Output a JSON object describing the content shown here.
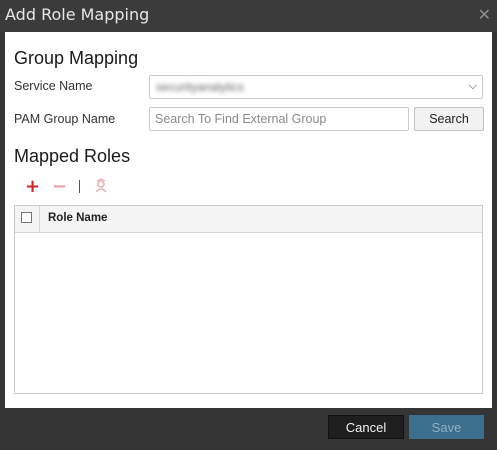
{
  "dialog": {
    "title": "Add Role Mapping",
    "close_icon": "close-icon"
  },
  "group_mapping": {
    "heading": "Group Mapping",
    "service_name_label": "Service Name",
    "service_name_value": "securityanalytics",
    "pam_group_label": "PAM Group Name",
    "pam_group_placeholder": "Search To Find External Group",
    "search_button": "Search"
  },
  "mapped_roles": {
    "heading": "Mapped Roles",
    "toolbar_icons": [
      "add-icon",
      "remove-icon",
      "role-icon"
    ],
    "columns": [
      "",
      "Role Name"
    ],
    "rows": []
  },
  "footer": {
    "cancel": "Cancel",
    "save": "Save"
  },
  "colors": {
    "add": "#d0202a",
    "remove_disabled": "#e9a2a5",
    "save_disabled": "#3b6f8d",
    "cancel": "#1e1e1e"
  }
}
